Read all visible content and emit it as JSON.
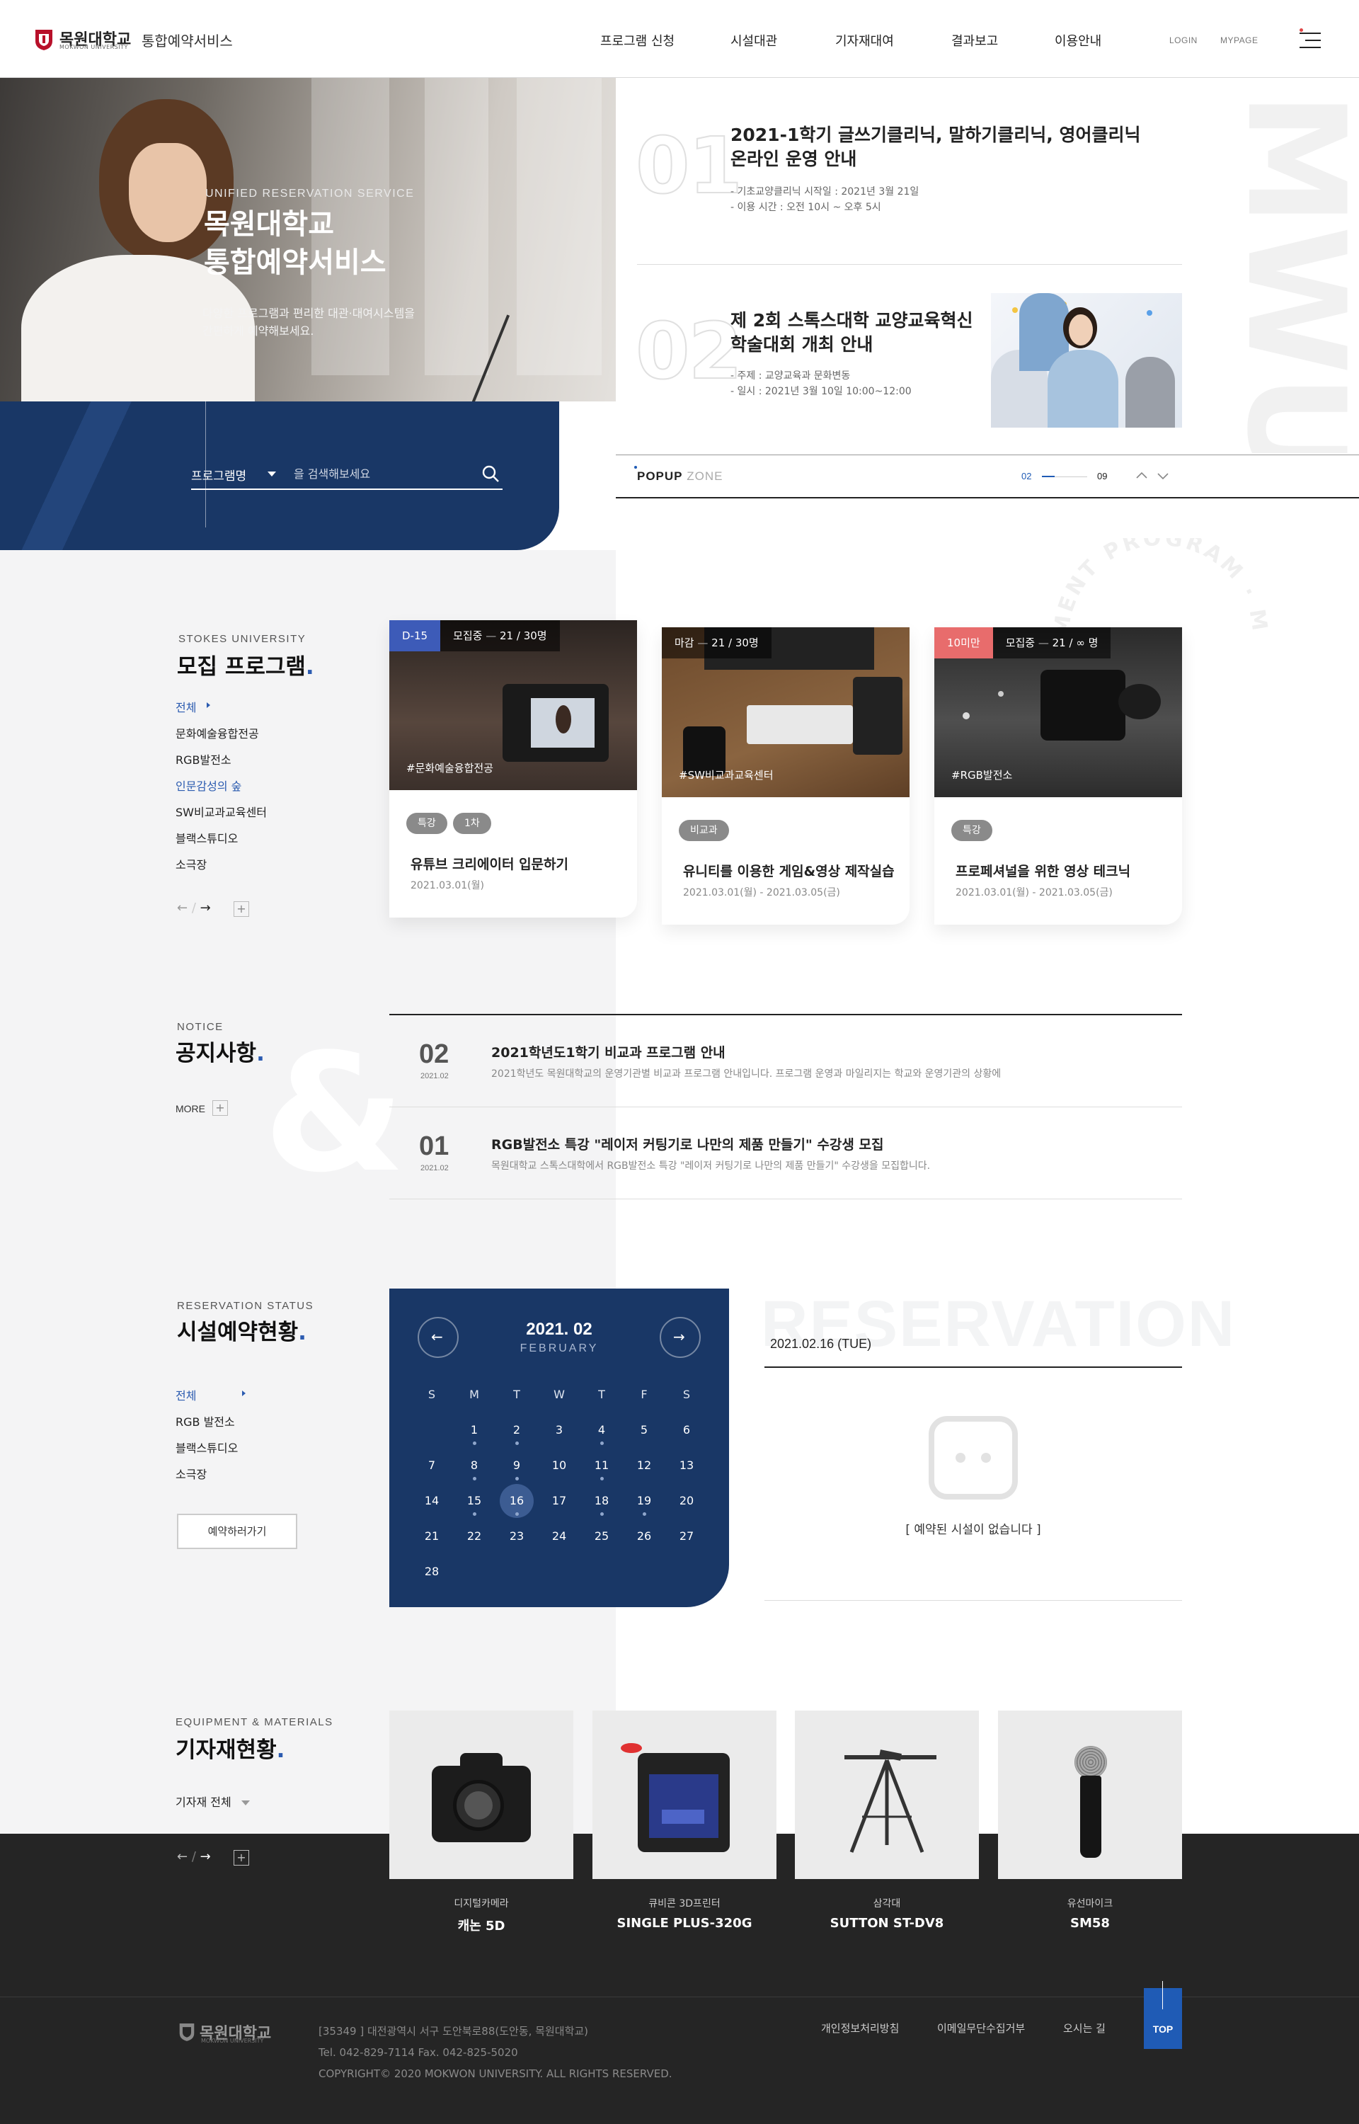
{
  "header": {
    "logo_name": "목원대학교",
    "logo_en": "MOKWON UNIVERSITY",
    "service_name": "통합예약서비스",
    "nav": [
      "프로그램 신청",
      "시설대관",
      "기자재대여",
      "결과보고",
      "이용안내"
    ],
    "util": [
      "LOGIN",
      "MYPAGE"
    ]
  },
  "hero": {
    "kicker": "UNIFIED RESERVATION SERVICE",
    "title_line1": "목원대학교",
    "title_line2": "통합예약서비스",
    "desc_line1": "다양한 프로그램과 편리한 대관·대여시스템을",
    "desc_line2": "간편하게 예약해보세요.",
    "search": {
      "select_label": "프로그램명",
      "placeholder": "을 검색해보세요"
    }
  },
  "popups": {
    "watermark": "MWU",
    "items": [
      {
        "num": "01",
        "title1": "2021-1학기 글쓰기클리닉, 말하기클리닉, 영어클리닉",
        "title2": "온라인 운영 안내",
        "meta1": "- 기초교양클리닉 시작일 : 2021년 3월 21일",
        "meta2": "- 이용 시간 : 오전 10시 ~ 오후 5시"
      },
      {
        "num": "02",
        "title1": "제 2회 스톡스대학 교양교육혁신",
        "title2": "학술대회 개최 안내",
        "meta1": "- 주제 : 교양교육과 문화변동",
        "meta2": "- 일시 : 2021년 3월 10일 10:00~12:00"
      }
    ],
    "zone_label_bold": "POPUP",
    "zone_label_light": "ZONE",
    "current": "02",
    "total": "09"
  },
  "programs": {
    "kicker": "STOKES UNIVERSITY",
    "title": "모집 프로그램",
    "categories": [
      "전체",
      "문화예술융합전공",
      "RGB발전소",
      "인문감성의 숲",
      "SW비교과교육센터",
      "블랙스튜디오",
      "소극장"
    ],
    "ring_text": "MENT PROGRAM · MOKWON",
    "cards": [
      {
        "badge": "D-15",
        "status": "모집중",
        "count": "21 / 30명",
        "tag": "#문화예술융합전공",
        "chips": [
          "특강",
          "1차"
        ],
        "title": "유튜브 크리에이터 입문하기",
        "date": "2021.03.01(월)"
      },
      {
        "badge": "마감",
        "status": "",
        "count": "21 / 30명",
        "tag": "#SW비교과교육센터",
        "chips": [
          "비교과"
        ],
        "title": "유니티를 이용한 게임&영상 제작실습",
        "date": "2021.03.01(월) - 2021.03.05(금)"
      },
      {
        "badge": "10미만",
        "status": "모집중",
        "count": "21 / ∞ 명",
        "tag": "#RGB발전소",
        "chips": [
          "특강"
        ],
        "title": "프로페셔널을 위한 영상 테크닉",
        "date": "2021.03.01(월) - 2021.03.05(금)"
      }
    ]
  },
  "notice": {
    "kicker": "NOTICE",
    "title": "공지사항",
    "more": "MORE",
    "watermark": "&",
    "items": [
      {
        "num": "02",
        "date": "2021.02",
        "title": "2021학년도1학기  비교과 프로그램 안내",
        "desc": "2021학년도  목원대학교의 운영기관별 비교과 프로그램 안내입니다. 프로그램 운영과 마일리지는 학교와 운영기관의 상황에"
      },
      {
        "num": "01",
        "date": "2021.02",
        "title": "RGB발전소 특강 \"레이저 커팅기로 나만의 제품 만들기\" 수강생 모집",
        "desc": "목원대학교 스톡스대학에서 RGB발전소 특강 \"레이저 커팅기로 나만의 제품 만들기\" 수강생을 모집합니다."
      }
    ]
  },
  "reservation": {
    "kicker": "RESERVATION STATUS",
    "title": "시설예약현황",
    "facilities": [
      "전체",
      "RGB 발전소",
      "블랙스튜디오",
      "소극장"
    ],
    "button": "예약하러가기",
    "calendar": {
      "month": "2021. 02",
      "month_name": "FEBRUARY",
      "dow": [
        "S",
        "M",
        "T",
        "W",
        "T",
        "F",
        "S"
      ],
      "first_weekday": 1,
      "days": 28,
      "selected": 16,
      "marked_days": [
        1,
        2,
        4,
        8,
        9,
        11,
        15,
        16,
        18,
        19
      ]
    },
    "watermark": "RESERVATION",
    "selected_date": "2021.02.16 (TUE)",
    "empty_message": "[ 예약된 시설이 없습니다 ]"
  },
  "equipment": {
    "kicker": "EQUIPMENT & MATERIALS",
    "title": "기자재현황",
    "filter": "기자재 전체",
    "items": [
      {
        "category": "디지털카메라",
        "name": "캐논 5D",
        "icon": "camera-icon"
      },
      {
        "category": "큐비콘 3D프린터",
        "name": "SINGLE PLUS-320G",
        "icon": "printer-icon"
      },
      {
        "category": "삼각대",
        "name": "SUTTON ST-DV8",
        "icon": "tripod-icon"
      },
      {
        "category": "유선마이크",
        "name": "SM58",
        "icon": "microphone-icon"
      }
    ]
  },
  "footer": {
    "logo": "목원대학교",
    "logo_en": "MOKWON UNIVERSITY",
    "address": "[35349 ] 대전광역시 서구 도안북로88(도안동, 목원대학교)",
    "contact": "Tel.  042-829-7114    Fax.  042-825-5020",
    "copyright": "COPYRIGHT© 2020 MOKWON UNIVERSITY. ALL RIGHTS RESERVED.",
    "links": [
      "개인정보처리방침",
      "이메일무단수집거부",
      "오시는 길"
    ],
    "top": "TOP"
  },
  "colors": {
    "brand_navy": "#193766",
    "accent_blue": "#1f5bb5",
    "red": "#e86c6c",
    "badge_blue": "#3d5bb8"
  }
}
